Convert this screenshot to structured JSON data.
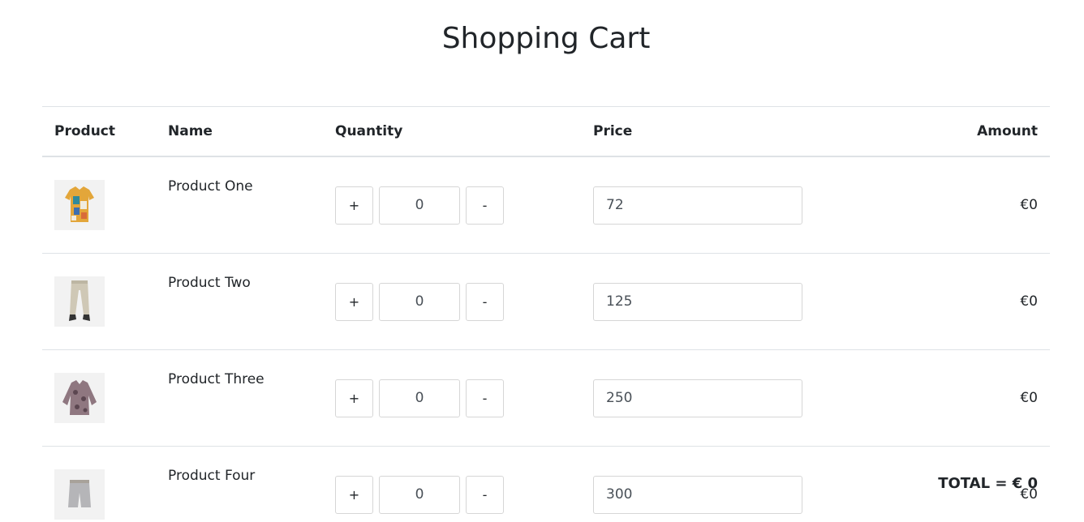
{
  "page": {
    "title": "Shopping Cart"
  },
  "table": {
    "headers": {
      "product": "Product",
      "name": "Name",
      "quantity": "Quantity",
      "price": "Price",
      "amount": "Amount"
    },
    "rows": [
      {
        "name": "Product One",
        "quantity": "0",
        "price": "72",
        "amount": "€0",
        "image": "colorful-shirt-image"
      },
      {
        "name": "Product Two",
        "quantity": "0",
        "price": "125",
        "amount": "€0",
        "image": "beige-pants-image"
      },
      {
        "name": "Product Three",
        "quantity": "0",
        "price": "250",
        "amount": "€0",
        "image": "patterned-blouse-image"
      },
      {
        "name": "Product Four",
        "quantity": "0",
        "price": "300",
        "amount": "€0",
        "image": "grey-shorts-image"
      }
    ],
    "increment_label": "+",
    "decrement_label": "-"
  },
  "total": {
    "label": "TOTAL = € 0"
  }
}
